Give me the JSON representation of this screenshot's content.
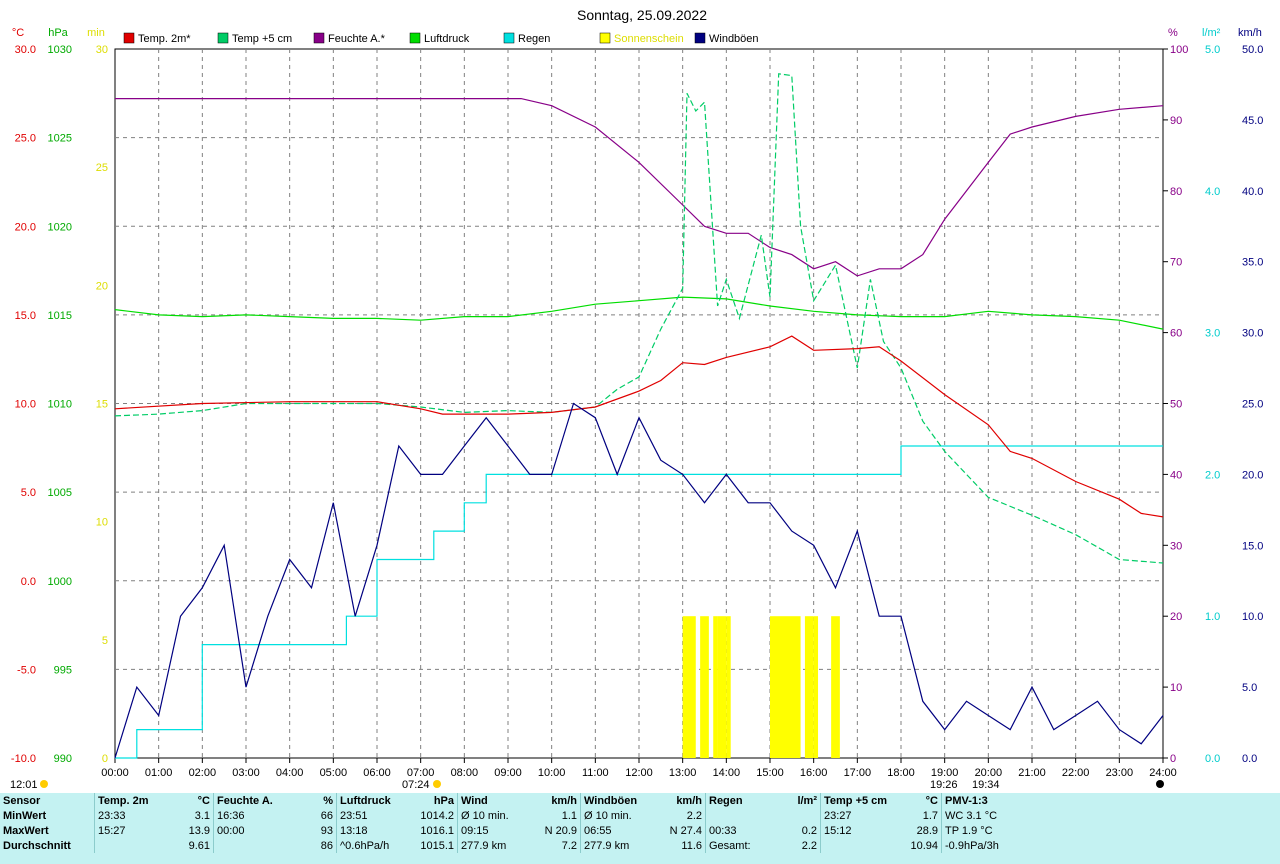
{
  "title": "Sonntag, 25.09.2022",
  "colors": {
    "temp2m": "#e00000",
    "temp5cm": "#00cc66",
    "humidity": "#880088",
    "pressure": "#00dd00",
    "rain": "#00e0e0",
    "sunshine": "#ffff00",
    "gust": "#000080",
    "grid": "#808080"
  },
  "legend": [
    {
      "label": "Temp. 2m*",
      "color": "#e00000"
    },
    {
      "label": "Temp +5 cm",
      "color": "#00cc66"
    },
    {
      "label": "Feuchte A.*",
      "color": "#880088"
    },
    {
      "label": "Luftdruck",
      "color": "#00dd00"
    },
    {
      "label": "Regen",
      "color": "#00e0e0"
    },
    {
      "label": "Sonnenschein",
      "color": "#ffff00"
    },
    {
      "label": "Windböen",
      "color": "#000080"
    }
  ],
  "chart_data": {
    "type": "line",
    "title": "Sonntag, 25.09.2022",
    "grid": true,
    "legend_position": "top",
    "x_ticks": [
      "00:00",
      "01:00",
      "02:00",
      "03:00",
      "04:00",
      "05:00",
      "06:00",
      "07:00",
      "08:00",
      "09:00",
      "10:00",
      "11:00",
      "12:00",
      "13:00",
      "14:00",
      "15:00",
      "16:00",
      "17:00",
      "18:00",
      "19:00",
      "20:00",
      "21:00",
      "22:00",
      "23:00",
      "24:00"
    ],
    "axes": {
      "temp": {
        "unit": "°C",
        "range": [
          -10,
          30
        ],
        "ticks": [
          "30.0",
          "25.0",
          "20.0",
          "15.0",
          "10.0",
          "5.0",
          "0.0",
          "-5.0",
          "-10.0"
        ]
      },
      "pressure": {
        "unit": "hPa",
        "range": [
          990,
          1030
        ],
        "ticks": [
          "1030",
          "1025",
          "1020",
          "1015",
          "1010",
          "1005",
          "1000",
          "995",
          "990"
        ]
      },
      "sunshine": {
        "unit": "min",
        "range": [
          0,
          30
        ],
        "ticks": [
          "30",
          "25",
          "20",
          "15",
          "10",
          "5",
          "0"
        ]
      },
      "humidity": {
        "unit": "%",
        "range": [
          0,
          100
        ],
        "ticks": [
          "100",
          "90",
          "80",
          "70",
          "60",
          "50",
          "40",
          "30",
          "20",
          "10",
          "0"
        ]
      },
      "rain": {
        "unit": "l/m²",
        "range": [
          0,
          5
        ],
        "ticks": [
          "5.0",
          "4.0",
          "3.0",
          "2.0",
          "1.0",
          "0.0"
        ]
      },
      "wind": {
        "unit": "km/h",
        "range": [
          0,
          50
        ],
        "ticks": [
          "50.0",
          "45.0",
          "40.0",
          "35.0",
          "30.0",
          "25.0",
          "20.0",
          "15.0",
          "10.0",
          "5.0",
          "0.0"
        ]
      }
    },
    "series": [
      {
        "name": "Temp. 2m*",
        "axis": "temp",
        "x": [
          0,
          2,
          4,
          6,
          7,
          7.5,
          9,
          10,
          11,
          12,
          12.5,
          13,
          13.5,
          14,
          15,
          15.5,
          16,
          17,
          17.5,
          18,
          19,
          20,
          20.5,
          21,
          22,
          23,
          23.5,
          24
        ],
        "y": [
          9.7,
          10,
          10.1,
          10.1,
          9.7,
          9.4,
          9.4,
          9.5,
          9.8,
          10.7,
          11.3,
          12.3,
          12.2,
          12.6,
          13.2,
          13.8,
          13.0,
          13.1,
          13.2,
          12.4,
          10.5,
          8.8,
          7.3,
          6.9,
          5.6,
          4.6,
          3.8,
          3.6
        ]
      },
      {
        "name": "Temp +5 cm",
        "axis": "temp",
        "x": [
          0,
          1,
          2,
          3,
          4,
          5,
          6,
          7,
          8,
          9,
          10,
          11,
          11.5,
          12,
          12.5,
          13,
          13.1,
          13.3,
          13.5,
          13.8,
          14,
          14.3,
          14.8,
          15,
          15.2,
          15.5,
          15.7,
          16,
          16.5,
          17,
          17.3,
          17.6,
          18,
          18.5,
          19,
          19.5,
          20,
          21,
          22,
          23,
          24
        ],
        "y": [
          9.3,
          9.4,
          9.6,
          10,
          10,
          10,
          10,
          9.8,
          9.5,
          9.6,
          9.5,
          9.8,
          10.8,
          11.5,
          14.2,
          16.5,
          27.5,
          26.5,
          27.0,
          15.5,
          17.0,
          14.8,
          19.5,
          16.0,
          28.6,
          28.5,
          20.0,
          15.8,
          17.8,
          12.0,
          17.0,
          13.5,
          12.0,
          9.0,
          7.3,
          6.0,
          4.7,
          3.7,
          2.6,
          1.2,
          1.0
        ]
      },
      {
        "name": "Feuchte A.*",
        "axis": "humidity",
        "x": [
          0,
          3,
          6,
          9,
          9.3,
          10,
          11,
          12,
          13,
          13.5,
          14,
          14.5,
          15,
          15.5,
          16,
          16.5,
          17,
          17.5,
          18,
          18.5,
          19,
          20,
          20.5,
          21,
          22,
          23,
          24
        ],
        "y": [
          93,
          93,
          93,
          93,
          93,
          92,
          89,
          84,
          78,
          75,
          74,
          74,
          72,
          71,
          69,
          70,
          68,
          69,
          69,
          71,
          76,
          84,
          88,
          89,
          90.5,
          91.5,
          92
        ]
      },
      {
        "name": "Luftdruck",
        "axis": "pressure",
        "x": [
          0,
          1,
          2,
          3,
          4,
          5,
          6,
          7,
          8,
          9,
          10,
          11,
          12,
          13,
          14,
          15,
          16,
          17,
          18,
          19,
          20,
          21,
          22,
          23,
          24
        ],
        "y": [
          1015.3,
          1015.0,
          1014.9,
          1015.0,
          1014.9,
          1014.8,
          1014.8,
          1014.7,
          1014.9,
          1014.9,
          1015.2,
          1015.6,
          1015.8,
          1016.0,
          1015.9,
          1015.5,
          1015.2,
          1015.0,
          1014.9,
          1014.9,
          1015.2,
          1015.0,
          1014.9,
          1014.7,
          1014.2
        ]
      },
      {
        "name": "Regen",
        "axis": "rain",
        "x": [
          0,
          0.5,
          1.5,
          2,
          4,
          5,
          5.3,
          5.8,
          6,
          6.5,
          7,
          7.3,
          7.7,
          8,
          8.3,
          8.5,
          9,
          10,
          11,
          12,
          13,
          14,
          15,
          16,
          17,
          17.9,
          18,
          19,
          20,
          21,
          22,
          23,
          24
        ],
        "y": [
          0,
          0.2,
          0.2,
          0.8,
          0.8,
          0.8,
          1.0,
          1.0,
          1.4,
          1.4,
          1.4,
          1.6,
          1.6,
          1.8,
          1.8,
          2.0,
          2.0,
          2.0,
          2.0,
          2.0,
          2.0,
          2.0,
          2.0,
          2.0,
          2.0,
          2.0,
          2.2,
          2.2,
          2.2,
          2.2,
          2.2,
          2.2,
          2.2
        ]
      },
      {
        "name": "Sonnenschein",
        "axis": "sunshine",
        "bars": [
          [
            13.0,
            13.3
          ],
          [
            13.4,
            13.6
          ],
          [
            13.7,
            13.8
          ],
          [
            13.8,
            14.0
          ],
          [
            14.0,
            14.1
          ],
          [
            15.0,
            15.7
          ],
          [
            15.8,
            16.0
          ],
          [
            16.0,
            16.1
          ],
          [
            16.4,
            16.6
          ]
        ],
        "y": 6
      },
      {
        "name": "Windböen",
        "axis": "wind",
        "x": [
          0,
          0.5,
          1,
          1.5,
          2,
          2.5,
          3,
          3.5,
          4,
          4.5,
          5,
          5.5,
          6,
          6.5,
          7,
          7.5,
          8,
          8.5,
          9,
          9.5,
          10,
          10.5,
          11,
          11.5,
          12,
          12.5,
          13,
          13.5,
          14,
          14.5,
          15,
          15.5,
          16,
          16.5,
          17,
          17.5,
          18,
          18.5,
          19,
          19.5,
          20,
          20.5,
          21,
          21.5,
          22,
          22.5,
          23,
          23.5,
          24
        ],
        "y": [
          0,
          5,
          3,
          10,
          12,
          15,
          5,
          10,
          14,
          12,
          18,
          10,
          15,
          22,
          20,
          20,
          22,
          24,
          22,
          20,
          20,
          25,
          24,
          20,
          24,
          21,
          20,
          18,
          20,
          18,
          18,
          16,
          15,
          12,
          16,
          10,
          10,
          4,
          2,
          4,
          3,
          2,
          5,
          2,
          3,
          4,
          2,
          1,
          3
        ]
      }
    ]
  },
  "stats": {
    "headers": [
      {
        "name": "Sensor",
        "unit": ""
      },
      {
        "name": "Temp. 2m",
        "unit": "°C"
      },
      {
        "name": "Feuchte A.",
        "unit": "%"
      },
      {
        "name": "Luftdruck",
        "unit": "hPa"
      },
      {
        "name": "Wind",
        "unit": "km/h"
      },
      {
        "name": "Windböen",
        "unit": "km/h"
      },
      {
        "name": "Regen",
        "unit": "l/m²"
      },
      {
        "name": "Temp +5 cm",
        "unit": "°C"
      },
      {
        "name": "PMV-1:3",
        "unit": ""
      }
    ],
    "rows": [
      {
        "label": "MinWert",
        "cells": [
          [
            "23:33",
            "3.1"
          ],
          [
            "16:36",
            "66"
          ],
          [
            "23:51",
            "1014.2"
          ],
          [
            "Ø 10 min.",
            "1.1"
          ],
          [
            "Ø 10 min.",
            "2.2"
          ],
          [
            "",
            ""
          ],
          [
            "23:27",
            "1.7"
          ],
          [
            "WC 3.1 °C",
            ""
          ]
        ]
      },
      {
        "label": "MaxWert",
        "cells": [
          [
            "15:27",
            "13.9"
          ],
          [
            "00:00",
            "93"
          ],
          [
            "13:18",
            "1016.1"
          ],
          [
            "09:15",
            "N 20.9"
          ],
          [
            "06:55",
            "N 27.4"
          ],
          [
            "00:33",
            "0.2"
          ],
          [
            "15:12",
            "28.9"
          ],
          [
            "TP 1.9 °C",
            ""
          ]
        ]
      },
      {
        "label": "Durchschnitt",
        "cells": [
          [
            "",
            "9.61"
          ],
          [
            "",
            "86"
          ],
          [
            "^0.6hPa/h",
            "1015.1"
          ],
          [
            "277.9 km",
            "7.2"
          ],
          [
            "277.9 km",
            "11.6"
          ],
          [
            "Gesamt:",
            "2.2"
          ],
          [
            "",
            "10.94"
          ],
          [
            "-0.9hPa/3h",
            ""
          ]
        ]
      }
    ]
  },
  "bottom_marks": {
    "left_time": "12:01",
    "sunrise": "07:24",
    "sunset": "19:26",
    "moon": "19:34"
  }
}
